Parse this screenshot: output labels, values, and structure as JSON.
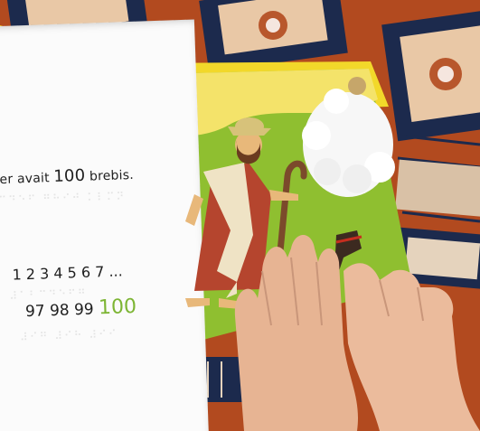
{
  "book": {
    "left_page": {
      "sentence_fragment": "erger avait",
      "number_100": "100",
      "word_brebis": "brebis.",
      "sequence_start": "1 2 3 4 5 6 7 ...",
      "sequence_end": "97 98 99",
      "sequence_final": "100"
    }
  },
  "colors": {
    "page_green": "#8fbf30",
    "page_yellow": "#f4e36a",
    "number_green": "#7db534",
    "fabric_orange": "#b24a1f"
  },
  "icons": [
    "shepherd-figure-icon",
    "sheep-cotton-icon",
    "crook-staff-icon",
    "small-animal-icon",
    "hand-icon"
  ]
}
